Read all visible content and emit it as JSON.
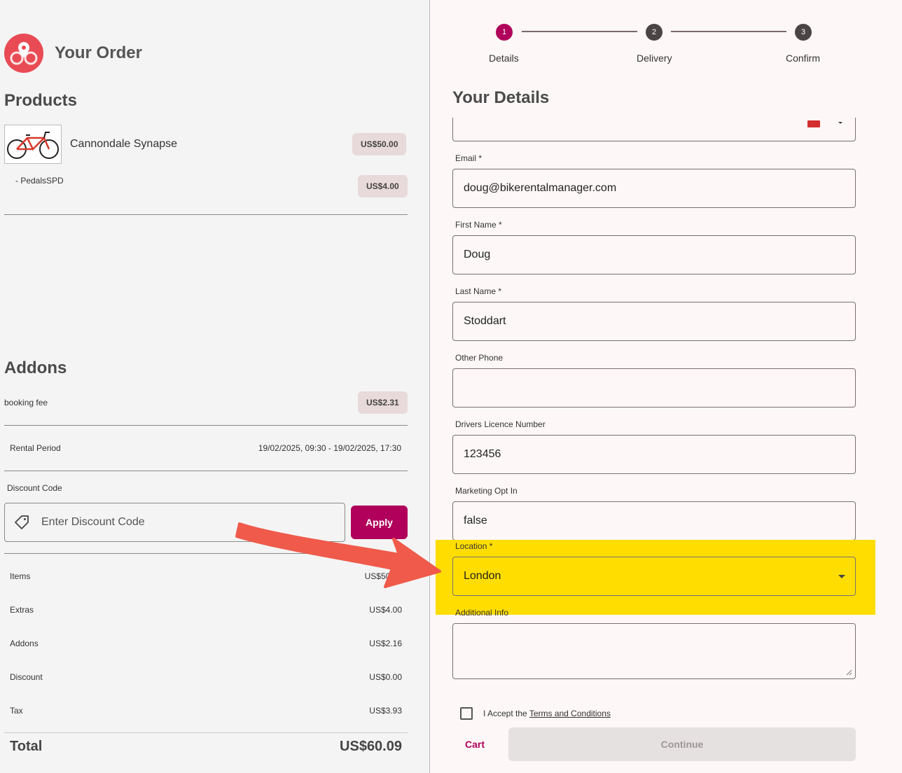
{
  "order": {
    "title": "Your Order",
    "products_heading": "Products",
    "product": {
      "name": "Cannondale Synapse",
      "price": "US$50.00"
    },
    "sub_item": {
      "name": "- PedalsSPD",
      "price": "US$4.00"
    },
    "addons_heading": "Addons",
    "addon": {
      "name": "booking fee",
      "price": "US$2.31"
    },
    "rental_period": {
      "label": "Rental Period",
      "value": "19/02/2025, 09:30 - 19/02/2025, 17:30"
    },
    "discount": {
      "label": "Discount Code",
      "placeholder": "Enter Discount Code",
      "apply_label": "Apply"
    },
    "summary": [
      {
        "label": "Items",
        "value": "US$50.00"
      },
      {
        "label": "Extras",
        "value": "US$4.00"
      },
      {
        "label": "Addons",
        "value": "US$2.16"
      },
      {
        "label": "Discount",
        "value": "US$0.00"
      },
      {
        "label": "Tax",
        "value": "US$3.93"
      }
    ],
    "total": {
      "label": "Total",
      "value": "US$60.09"
    }
  },
  "stepper": {
    "steps": [
      {
        "num": "1",
        "label": "Details",
        "active": true
      },
      {
        "num": "2",
        "label": "Delivery",
        "active": false
      },
      {
        "num": "3",
        "label": "Confirm",
        "active": false
      }
    ]
  },
  "details": {
    "heading": "Your Details",
    "email": {
      "label": "Email *",
      "value": "doug@bikerentalmanager.com"
    },
    "first_name": {
      "label": "First Name *",
      "value": "Doug"
    },
    "last_name": {
      "label": "Last Name *",
      "value": "Stoddart"
    },
    "other_phone": {
      "label": "Other Phone",
      "value": ""
    },
    "licence": {
      "label": "Drivers Licence Number",
      "value": "123456"
    },
    "marketing": {
      "label": "Marketing Opt In",
      "value": "false"
    },
    "location": {
      "label": "Location *",
      "value": "London"
    },
    "additional_info": {
      "label": "Additional Info",
      "value": ""
    },
    "terms": {
      "prefix": "I Accept the ",
      "link": "Terms and Conditions"
    },
    "cart_label": "Cart",
    "continue_label": "Continue"
  },
  "colors": {
    "accent": "#b0005b",
    "highlight": "#ffdd00",
    "arrow": "#f05a4a",
    "logo": "#e94b55"
  }
}
